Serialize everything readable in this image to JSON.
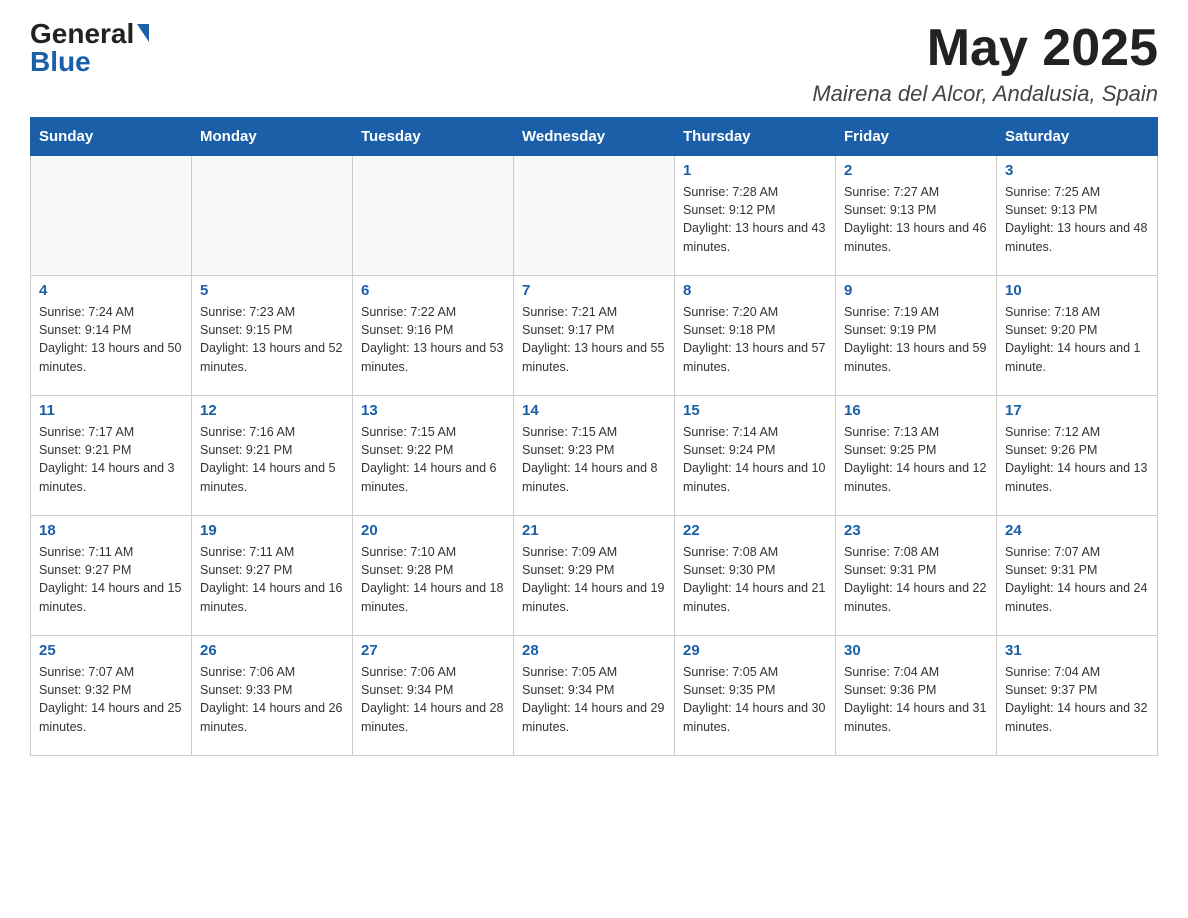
{
  "header": {
    "logo_general": "General",
    "logo_blue": "Blue",
    "title": "May 2025",
    "subtitle": "Mairena del Alcor, Andalusia, Spain"
  },
  "weekdays": [
    "Sunday",
    "Monday",
    "Tuesday",
    "Wednesday",
    "Thursday",
    "Friday",
    "Saturday"
  ],
  "weeks": [
    [
      {
        "day": "",
        "info": ""
      },
      {
        "day": "",
        "info": ""
      },
      {
        "day": "",
        "info": ""
      },
      {
        "day": "",
        "info": ""
      },
      {
        "day": "1",
        "info": "Sunrise: 7:28 AM\nSunset: 9:12 PM\nDaylight: 13 hours and 43 minutes."
      },
      {
        "day": "2",
        "info": "Sunrise: 7:27 AM\nSunset: 9:13 PM\nDaylight: 13 hours and 46 minutes."
      },
      {
        "day": "3",
        "info": "Sunrise: 7:25 AM\nSunset: 9:13 PM\nDaylight: 13 hours and 48 minutes."
      }
    ],
    [
      {
        "day": "4",
        "info": "Sunrise: 7:24 AM\nSunset: 9:14 PM\nDaylight: 13 hours and 50 minutes."
      },
      {
        "day": "5",
        "info": "Sunrise: 7:23 AM\nSunset: 9:15 PM\nDaylight: 13 hours and 52 minutes."
      },
      {
        "day": "6",
        "info": "Sunrise: 7:22 AM\nSunset: 9:16 PM\nDaylight: 13 hours and 53 minutes."
      },
      {
        "day": "7",
        "info": "Sunrise: 7:21 AM\nSunset: 9:17 PM\nDaylight: 13 hours and 55 minutes."
      },
      {
        "day": "8",
        "info": "Sunrise: 7:20 AM\nSunset: 9:18 PM\nDaylight: 13 hours and 57 minutes."
      },
      {
        "day": "9",
        "info": "Sunrise: 7:19 AM\nSunset: 9:19 PM\nDaylight: 13 hours and 59 minutes."
      },
      {
        "day": "10",
        "info": "Sunrise: 7:18 AM\nSunset: 9:20 PM\nDaylight: 14 hours and 1 minute."
      }
    ],
    [
      {
        "day": "11",
        "info": "Sunrise: 7:17 AM\nSunset: 9:21 PM\nDaylight: 14 hours and 3 minutes."
      },
      {
        "day": "12",
        "info": "Sunrise: 7:16 AM\nSunset: 9:21 PM\nDaylight: 14 hours and 5 minutes."
      },
      {
        "day": "13",
        "info": "Sunrise: 7:15 AM\nSunset: 9:22 PM\nDaylight: 14 hours and 6 minutes."
      },
      {
        "day": "14",
        "info": "Sunrise: 7:15 AM\nSunset: 9:23 PM\nDaylight: 14 hours and 8 minutes."
      },
      {
        "day": "15",
        "info": "Sunrise: 7:14 AM\nSunset: 9:24 PM\nDaylight: 14 hours and 10 minutes."
      },
      {
        "day": "16",
        "info": "Sunrise: 7:13 AM\nSunset: 9:25 PM\nDaylight: 14 hours and 12 minutes."
      },
      {
        "day": "17",
        "info": "Sunrise: 7:12 AM\nSunset: 9:26 PM\nDaylight: 14 hours and 13 minutes."
      }
    ],
    [
      {
        "day": "18",
        "info": "Sunrise: 7:11 AM\nSunset: 9:27 PM\nDaylight: 14 hours and 15 minutes."
      },
      {
        "day": "19",
        "info": "Sunrise: 7:11 AM\nSunset: 9:27 PM\nDaylight: 14 hours and 16 minutes."
      },
      {
        "day": "20",
        "info": "Sunrise: 7:10 AM\nSunset: 9:28 PM\nDaylight: 14 hours and 18 minutes."
      },
      {
        "day": "21",
        "info": "Sunrise: 7:09 AM\nSunset: 9:29 PM\nDaylight: 14 hours and 19 minutes."
      },
      {
        "day": "22",
        "info": "Sunrise: 7:08 AM\nSunset: 9:30 PM\nDaylight: 14 hours and 21 minutes."
      },
      {
        "day": "23",
        "info": "Sunrise: 7:08 AM\nSunset: 9:31 PM\nDaylight: 14 hours and 22 minutes."
      },
      {
        "day": "24",
        "info": "Sunrise: 7:07 AM\nSunset: 9:31 PM\nDaylight: 14 hours and 24 minutes."
      }
    ],
    [
      {
        "day": "25",
        "info": "Sunrise: 7:07 AM\nSunset: 9:32 PM\nDaylight: 14 hours and 25 minutes."
      },
      {
        "day": "26",
        "info": "Sunrise: 7:06 AM\nSunset: 9:33 PM\nDaylight: 14 hours and 26 minutes."
      },
      {
        "day": "27",
        "info": "Sunrise: 7:06 AM\nSunset: 9:34 PM\nDaylight: 14 hours and 28 minutes."
      },
      {
        "day": "28",
        "info": "Sunrise: 7:05 AM\nSunset: 9:34 PM\nDaylight: 14 hours and 29 minutes."
      },
      {
        "day": "29",
        "info": "Sunrise: 7:05 AM\nSunset: 9:35 PM\nDaylight: 14 hours and 30 minutes."
      },
      {
        "day": "30",
        "info": "Sunrise: 7:04 AM\nSunset: 9:36 PM\nDaylight: 14 hours and 31 minutes."
      },
      {
        "day": "31",
        "info": "Sunrise: 7:04 AM\nSunset: 9:37 PM\nDaylight: 14 hours and 32 minutes."
      }
    ]
  ]
}
